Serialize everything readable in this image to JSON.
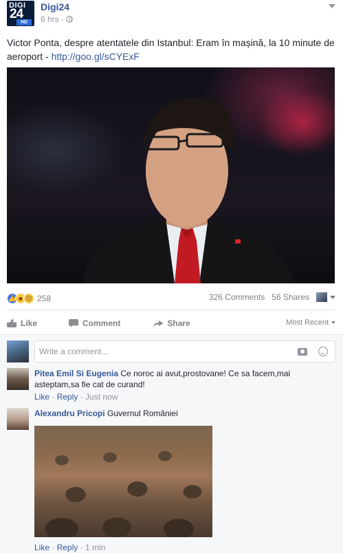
{
  "post": {
    "page_name": "Digi24",
    "time": "6 hrs",
    "separator": "·",
    "logo": {
      "line1": "DIGI",
      "line2": "24",
      "badge": "HD"
    },
    "text": "Victor Ponta, despre atentatele din Istanbul: Eram în mașină, la 10 minute de aeroport - ",
    "link": "http://goo.gl/sCYExF"
  },
  "stats": {
    "reaction_icons": [
      "like-icon",
      "haha-icon",
      "sad-icon"
    ],
    "reaction_count": "258",
    "comments": "326 Comments",
    "shares": "56 Shares"
  },
  "actions": {
    "like": "Like",
    "comment": "Comment",
    "share": "Share",
    "sort": "Most Recent"
  },
  "composer": {
    "placeholder": "Write a comment..."
  },
  "comments": [
    {
      "name": "Pitea Emil Si Eugenia",
      "text": "Ce noroc ai avut,prostovane! Ce sa facem,mai asteptam,sa fie cat de curand!",
      "like": "Like",
      "reply": "Reply",
      "time": "Just now"
    },
    {
      "name": "Alexandru Pricopi",
      "text": "Guvernul României",
      "like": "Like",
      "reply": "Reply",
      "time": "1 min"
    }
  ],
  "colors": {
    "link": "#365899",
    "muted": "#90949c",
    "like_blue": "#4a76e8"
  }
}
